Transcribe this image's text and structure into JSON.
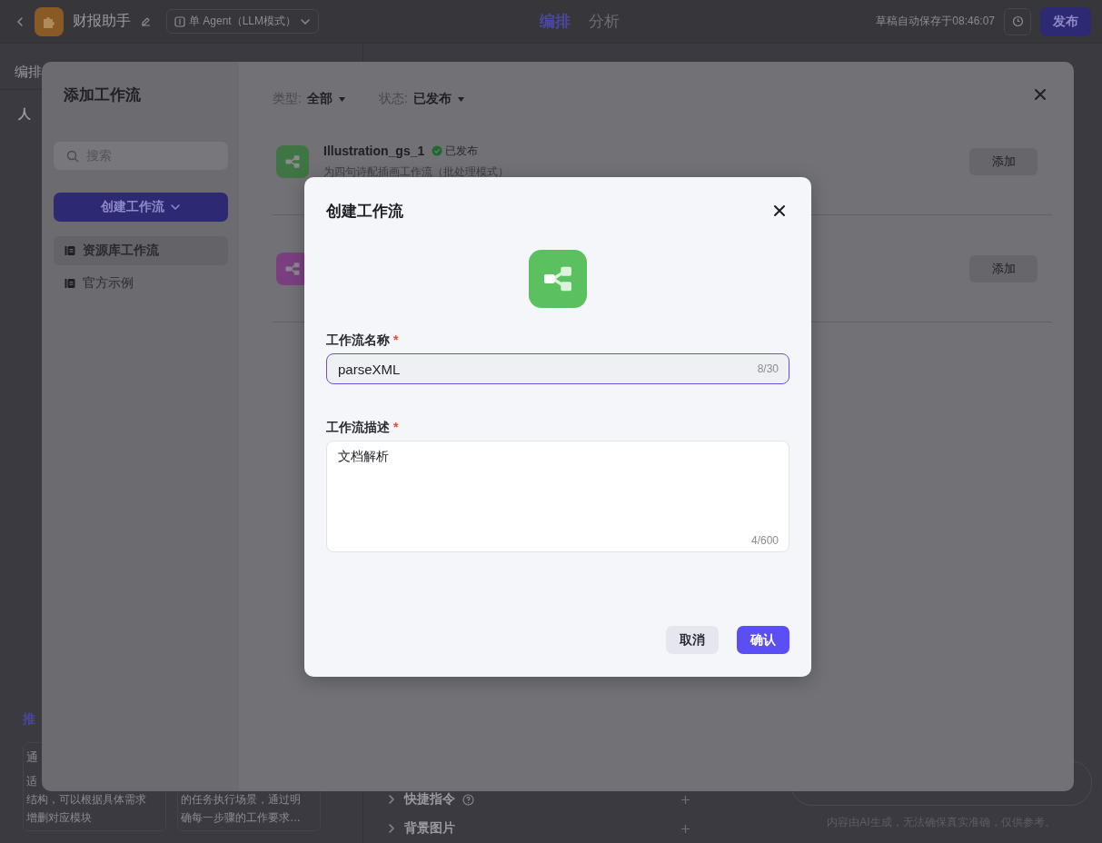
{
  "app": {
    "topbar": {
      "app_name": "财报助手",
      "mode": "单 Agent（LLM模式）",
      "tabs": [
        {
          "label": "编排",
          "selected": true
        },
        {
          "label": "分析",
          "selected": false
        }
      ],
      "save_status": "草稿自动保存于08:46:07",
      "publish": "发布"
    },
    "left": {
      "header": "编排",
      "section": "人",
      "recommend_title": "推",
      "cards": [
        {
          "title": "通",
          "lines": [
            "适",
            "结构，可以根据具体需求",
            "增删对应模块"
          ]
        },
        {
          "lines": [
            "的任务执行场景，通过明",
            "确每一步骤的工作要求…"
          ]
        }
      ]
    },
    "settings_rows": [
      {
        "label": "快捷指令",
        "help": true
      },
      {
        "label": "背景图片",
        "help": false
      }
    ],
    "disclaimer": "内容由AI生成，无法确保真实准确，仅供参考。"
  },
  "modal": {
    "title": "添加工作流",
    "search": {
      "placeholder": "搜索"
    },
    "create_button": "创建工作流",
    "sidebar": {
      "items": [
        {
          "label": "资源库工作流",
          "selected": true
        },
        {
          "label": "官方示例",
          "selected": false
        }
      ]
    },
    "filters": [
      {
        "label": "类型:",
        "value": "全部"
      },
      {
        "label": "状态:",
        "value": "已发布"
      }
    ],
    "workflows": [
      {
        "title": "Illustration_gs_1",
        "status": "已发布",
        "description": "为四句诗配插画工作流（批处理模式）",
        "color": "#3f7444",
        "add": "添加"
      },
      {
        "color": "#7b3f80",
        "add": "添加"
      }
    ]
  },
  "dialog": {
    "title": "创建工作流",
    "fields": [
      {
        "kind": "input",
        "label": "工作流名称",
        "required_mark": "*",
        "value": "parseXML",
        "count": "8/30",
        "focused": true
      },
      {
        "kind": "textarea",
        "label": "工作流描述",
        "required_mark": "*",
        "value": "文档解析",
        "count": "4/600",
        "focused": false
      }
    ],
    "buttons": [
      {
        "label": "取消",
        "kind": "secondary"
      },
      {
        "label": "确认",
        "kind": "primary"
      }
    ]
  }
}
